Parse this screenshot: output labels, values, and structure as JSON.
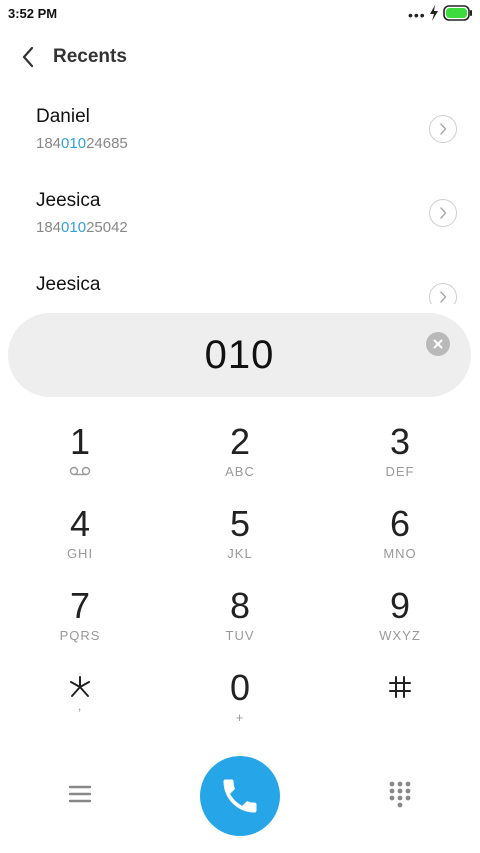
{
  "status_bar": {
    "time": "3:52 PM",
    "battery_color": "#3ddc3d"
  },
  "header": {
    "title": "Recents",
    "back_icon": "chevron-left-icon"
  },
  "recents": [
    {
      "name": "Daniel",
      "number_prefix": "184",
      "number_match": "010",
      "number_suffix": "24685"
    },
    {
      "name": "Jeesica",
      "number_prefix": "184",
      "number_match": "010",
      "number_suffix": "25042"
    },
    {
      "name": "Jeesica",
      "number_prefix": "",
      "number_match": "",
      "number_suffix": ""
    }
  ],
  "dialer": {
    "input_value": "010",
    "clear_icon": "clear-icon"
  },
  "keypad": {
    "keys": [
      {
        "digit": "1",
        "letters": ""
      },
      {
        "digit": "2",
        "letters": "ABC"
      },
      {
        "digit": "3",
        "letters": "DEF"
      },
      {
        "digit": "4",
        "letters": "GHI"
      },
      {
        "digit": "5",
        "letters": "JKL"
      },
      {
        "digit": "6",
        "letters": "MNO"
      },
      {
        "digit": "7",
        "letters": "PQRS"
      },
      {
        "digit": "8",
        "letters": "TUV"
      },
      {
        "digit": "9",
        "letters": "WXYZ"
      },
      {
        "digit": "",
        "letters": ","
      },
      {
        "digit": "0",
        "letters": "+"
      },
      {
        "digit": "",
        "letters": ""
      }
    ]
  },
  "bottom_bar": {
    "accent_color": "#26a6e8",
    "menu_icon": "menu-icon",
    "call_icon": "phone-icon",
    "keypad_icon": "dialpad-icon"
  }
}
